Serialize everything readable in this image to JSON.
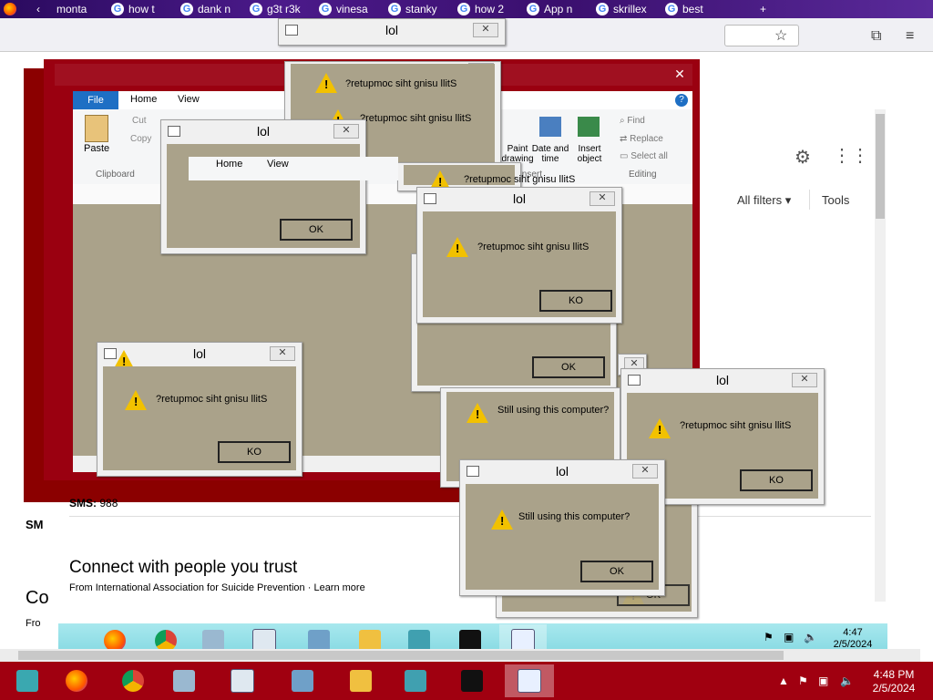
{
  "browser": {
    "tabs": [
      "monta",
      "how t",
      "dank n",
      "g3t r3k",
      "vinesa",
      "stanky",
      "how 2",
      "App n",
      "skrillex",
      "best"
    ],
    "new_tab": "+"
  },
  "paint": {
    "ribbon_tabs": {
      "file": "File",
      "home": "Home",
      "view": "View"
    },
    "clipboard": {
      "paste": "Paste",
      "cut": "Cut",
      "copy": "Copy",
      "group": "Clipboard"
    },
    "insert": {
      "paint_drawing": "Paint drawing",
      "date_time": "Date and time",
      "insert_object": "Insert object",
      "group": "Insert"
    },
    "editing": {
      "find": "Find",
      "replace": "Replace",
      "select_all": "Select all",
      "group": "Editing"
    }
  },
  "page": {
    "sms_label": "SMS:",
    "sms_value": "988",
    "sms_left": "SM",
    "connect_heading": "Connect with people you trust",
    "from_prefix": "From",
    "from_link": "International Association for Suicide Prevention",
    "sep": "·",
    "learn_more": "Learn more",
    "co_left": "Co",
    "fro_left": "Fro",
    "all_filters": "All filters",
    "tools": "Tools"
  },
  "dialogs": {
    "title": "lol",
    "reversed_message": "?retupmoc siht gnisu llitS",
    "message": "Still using this computer?",
    "ok": "OK",
    "ko": "KO"
  },
  "taskbar": {
    "inner_clock_time": "4:47",
    "inner_clock_date": "2/5/2024",
    "clock_time": "4:48 PM",
    "clock_date": "2/5/2024"
  },
  "colors": {
    "dialog_body": "#aaa28a",
    "warning": "#f2c100",
    "taskbar_red": "#a00010",
    "inner_taskbar": "#86d9e2"
  }
}
